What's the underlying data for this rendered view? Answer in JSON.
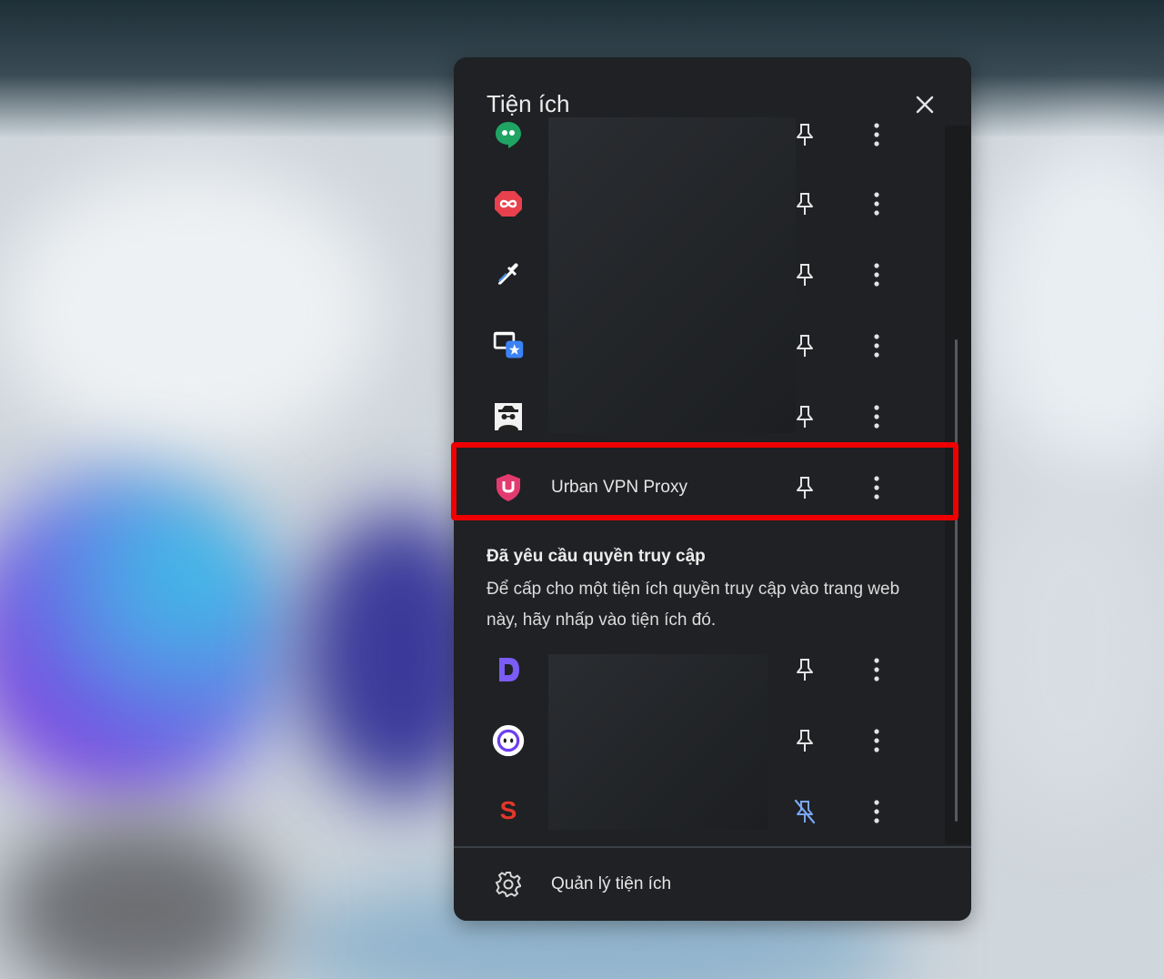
{
  "panel": {
    "title": "Tiện ích",
    "close_icon": "close-icon"
  },
  "extensions_top": [
    {
      "icon": "google-hangouts-icon",
      "name": "",
      "pin_icon": "pin-icon",
      "menu_icon": "more-vertical-icon"
    },
    {
      "icon": "infinity-hexagon-icon",
      "name": "",
      "pin_icon": "pin-icon",
      "menu_icon": "more-vertical-icon"
    },
    {
      "icon": "eyedropper-icon",
      "name": "",
      "pin_icon": "pin-icon",
      "menu_icon": "more-vertical-icon"
    },
    {
      "icon": "window-star-icon",
      "name": "",
      "pin_icon": "pin-icon",
      "menu_icon": "more-vertical-icon"
    },
    {
      "icon": "incognito-spy-icon",
      "name": "",
      "pin_icon": "pin-icon",
      "menu_icon": "more-vertical-icon"
    },
    {
      "icon": "urban-vpn-shield-icon",
      "name": "Urban VPN Proxy",
      "pin_icon": "pin-icon",
      "menu_icon": "more-vertical-icon",
      "highlighted": true
    }
  ],
  "access_section": {
    "heading": "Đã yêu cầu quyền truy cập",
    "description": "Để cấp cho một tiện ích quyền truy cập vào trang web này, hãy nhấp vào tiện ích đó."
  },
  "extensions_bottom": [
    {
      "icon": "letter-d-icon",
      "name": "",
      "pin_icon": "pin-icon",
      "menu_icon": "more-vertical-icon"
    },
    {
      "icon": "robot-face-icon",
      "name": "",
      "pin_icon": "pin-icon",
      "menu_icon": "more-vertical-icon"
    },
    {
      "icon": "seo-s-icon",
      "name": "",
      "pin_icon": "pinned-icon",
      "menu_icon": "more-vertical-icon",
      "pinned": true
    }
  ],
  "footer": {
    "icon": "gear-icon",
    "label": "Quản lý tiện ích"
  },
  "colors": {
    "panel_bg": "#1f2124",
    "highlight_border": "#ee0000",
    "pinned_accent": "#7aa7f5"
  }
}
